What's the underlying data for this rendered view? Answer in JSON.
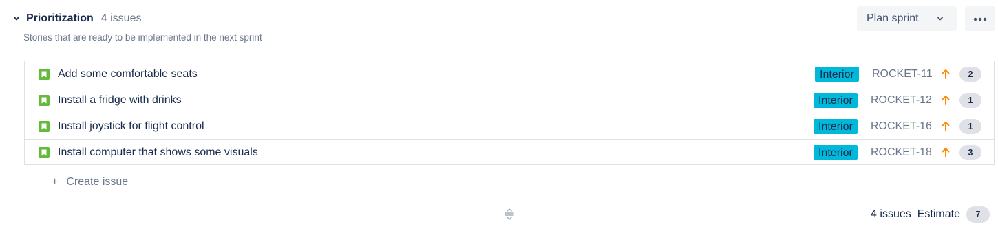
{
  "section": {
    "title": "Prioritization",
    "issue_count": "4 issues",
    "description": "Stories that are ready to be implemented in the next sprint",
    "plan_label": "Plan sprint"
  },
  "issues": [
    {
      "summary": "Add some comfortable seats",
      "label": "Interior",
      "key": "ROCKET-11",
      "priority": "high",
      "estimate": "2"
    },
    {
      "summary": "Install a fridge with drinks",
      "label": "Interior",
      "key": "ROCKET-12",
      "priority": "high",
      "estimate": "1"
    },
    {
      "summary": "Install joystick for flight control",
      "label": "Interior",
      "key": "ROCKET-16",
      "priority": "high",
      "estimate": "1"
    },
    {
      "summary": "Install computer that shows some visuals",
      "label": "Interior",
      "key": "ROCKET-18",
      "priority": "high",
      "estimate": "3"
    }
  ],
  "create_label": "Create issue",
  "footer": {
    "issue_count": "4 issues",
    "estimate_label": "Estimate",
    "estimate_total": "7"
  },
  "colors": {
    "story": "#63ba3c",
    "label_bg": "#00b8d9",
    "priority_high": "#ff8b00"
  },
  "icons": {
    "collapse": "chevron-down-icon",
    "plan_dropdown": "chevron-down-icon",
    "more": "more-icon",
    "story": "story-icon",
    "priority": "priority-high-icon",
    "create": "plus-icon",
    "resize": "drag-handle-icon"
  }
}
